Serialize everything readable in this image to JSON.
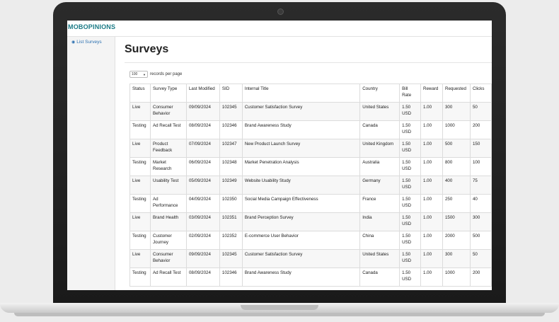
{
  "app": {
    "brand": "MOBOPINIONS"
  },
  "sidebar": {
    "items": [
      {
        "label": "List Surveys",
        "icon": "dashboard-icon"
      }
    ]
  },
  "page": {
    "title": "Surveys"
  },
  "controls": {
    "page_size": "100",
    "page_size_suffix": "records per page"
  },
  "table": {
    "headers": [
      "Status",
      "Survey Type",
      "Last Modified",
      "SID",
      "Internal Title",
      "Country",
      "Bill Rate",
      "Reward",
      "Requested",
      "Clicks"
    ],
    "rows": [
      [
        "Live",
        "Consumer Behavior",
        "09/09/2024",
        "102345",
        "Customer Satisfaction Survey",
        "United States",
        "1.50 USD",
        "1.00",
        "300",
        "50"
      ],
      [
        "Testing",
        "Ad Recall Test",
        "08/09/2024",
        "102346",
        "Brand Awareness Study",
        "Canada",
        "1.50 USD",
        "1.00",
        "1000",
        "200"
      ],
      [
        "Live",
        "Product Feedback",
        "07/09/2024",
        "102347",
        "New Product Launch Survey",
        "United Kingdom",
        "1.50 USD",
        "1.00",
        "500",
        "150"
      ],
      [
        "Testing",
        "Market Research",
        "06/09/2024",
        "102348",
        "Market Penetration Analysis",
        "Australia",
        "1.50 USD",
        "1.00",
        "800",
        "100"
      ],
      [
        "Live",
        "Usability Test",
        "05/09/2024",
        "102349",
        "Website Usability Study",
        "Germany",
        "1.50 USD",
        "1.00",
        "400",
        "75"
      ],
      [
        "Testing",
        "Ad Performance",
        "04/09/2024",
        "102350",
        "Social Media Campaign Effectiveness",
        "France",
        "1.50 USD",
        "1.00",
        "250",
        "40"
      ],
      [
        "Live",
        "Brand Health",
        "03/09/2024",
        "102351",
        "Brand Perception Survey",
        "India",
        "1.50 USD",
        "1.00",
        "1500",
        "300"
      ],
      [
        "Testing",
        "Customer Journey",
        "02/09/2024",
        "102352",
        "E-commerce User Behavior",
        "China",
        "1.50 USD",
        "1.00",
        "2000",
        "500"
      ],
      [
        "Live",
        "Consumer Behavior",
        "09/09/2024",
        "102345",
        "Customer Satisfaction Survey",
        "United States",
        "1.50 USD",
        "1.00",
        "300",
        "50"
      ],
      [
        "Testing",
        "Ad Recall Test",
        "08/09/2024",
        "102346",
        "Brand Awareness Study",
        "Canada",
        "1.50 USD",
        "1.00",
        "1000",
        "200"
      ]
    ]
  },
  "colors": {
    "brand": "#1a7a86",
    "link": "#2a6fb0"
  }
}
